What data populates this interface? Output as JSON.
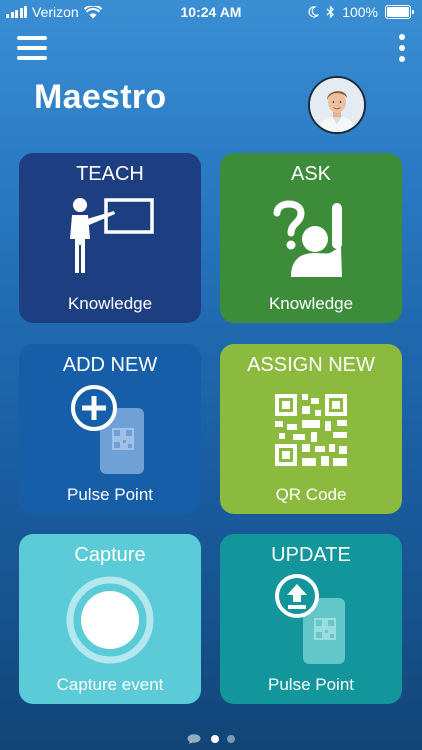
{
  "status_bar": {
    "carrier": "Verizon",
    "time": "10:24 AM",
    "battery": "100%",
    "icons": [
      "signal-icon",
      "wifi-icon",
      "moon-icon",
      "bluetooth-icon",
      "battery-icon"
    ]
  },
  "header": {
    "title": "Maestro",
    "menu_icon": "hamburger-menu-icon",
    "more_icon": "kebab-menu-icon"
  },
  "tiles": [
    {
      "top": "TEACH",
      "bottom": "Knowledge",
      "icon": "teacher-board-icon",
      "color": "#1e3e82"
    },
    {
      "top": "ASK",
      "bottom": "Knowledge",
      "icon": "question-raise-hand-icon",
      "color": "#3c8c3a"
    },
    {
      "top": "ADD NEW",
      "bottom": "Pulse Point",
      "icon": "add-phone-qr-icon",
      "color": "#165ea8"
    },
    {
      "top": "ASSIGN NEW",
      "bottom": "QR Code",
      "icon": "qr-code-icon",
      "color": "#8bba3e"
    },
    {
      "top": "Capture",
      "bottom": "Capture event",
      "icon": "capture-circle-icon",
      "color": "#5bcbd8"
    },
    {
      "top": "UPDATE",
      "bottom": "Pulse Point",
      "icon": "update-phone-qr-icon",
      "color": "#12969b"
    }
  ],
  "pager": {
    "count": 2,
    "active": 0
  }
}
